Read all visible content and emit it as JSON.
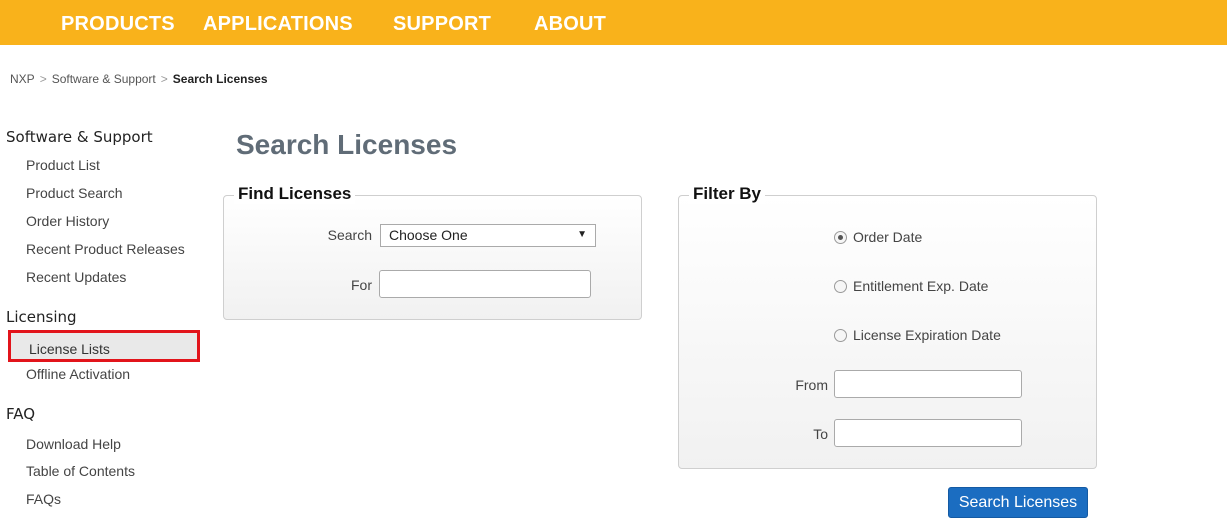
{
  "topnav": {
    "bg_color": "#f9b21b",
    "items": [
      "PRODUCTS",
      "APPLICATIONS",
      "SUPPORT",
      "ABOUT"
    ]
  },
  "breadcrumb": {
    "items": [
      "NXP",
      "Software & Support"
    ],
    "separator": ">",
    "current": "Search Licenses"
  },
  "sidebar": {
    "sections": [
      {
        "title": "Software & Support",
        "items": [
          "Product List",
          "Product Search",
          "Order History",
          "Recent Product Releases",
          "Recent Updates"
        ]
      },
      {
        "title": "Licensing",
        "items": [
          "License Lists",
          "Offline Activation"
        ]
      },
      {
        "title": "FAQ",
        "items": [
          "Download Help",
          "Table of Contents",
          "FAQs"
        ]
      }
    ],
    "active_item": "License Lists",
    "highlight_color": "#e2141b"
  },
  "main": {
    "title": "Search Licenses",
    "find": {
      "legend": "Find Licenses",
      "search_label": "Search",
      "search_value": "Choose One",
      "for_label": "For",
      "for_value": ""
    },
    "filter": {
      "legend": "Filter By",
      "options": [
        "Order Date",
        "Entitlement Exp. Date",
        "License Expiration Date"
      ],
      "selected": "Order Date",
      "from_label": "From",
      "from_value": "",
      "to_label": "To",
      "to_value": ""
    },
    "submit_label": "Search Licenses",
    "button_color": "#1b6dc1"
  }
}
